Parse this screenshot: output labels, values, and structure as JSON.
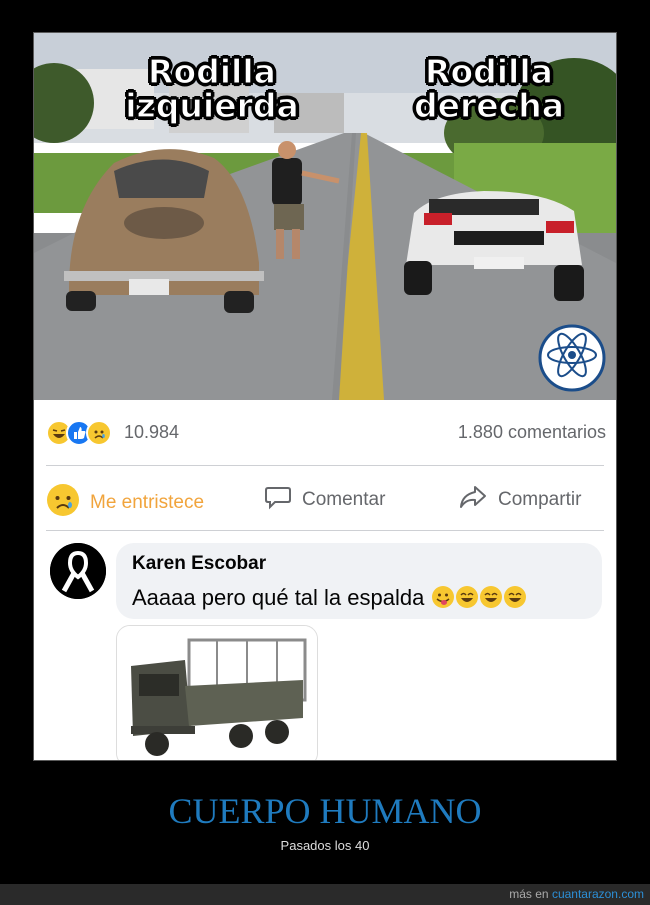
{
  "meme": {
    "caption_left_line1": "Rodilla",
    "caption_left_line2": "izquierda",
    "caption_right_line1": "Rodilla",
    "caption_right_line2": "derecha"
  },
  "post": {
    "reaction_count": "10.984",
    "comment_count": "1.880 comentarios",
    "reaction_icons": [
      "haha-icon",
      "like-icon",
      "sad-icon"
    ]
  },
  "actions": {
    "sad_label": "Me entristece",
    "comment_label": "Comentar",
    "share_label": "Compartir"
  },
  "comment": {
    "author": "Karen Escobar",
    "text": "Aaaaa pero qué tal la espalda"
  },
  "page": {
    "title": "CUERPO HUMANO",
    "subtitle": "Pasados los 40",
    "footer_prefix": "más en ",
    "footer_link": "cuantarazon.com"
  },
  "colors": {
    "title": "#1f7bbf",
    "sad_accent": "#f1a43c",
    "link": "#2c8fd6"
  }
}
